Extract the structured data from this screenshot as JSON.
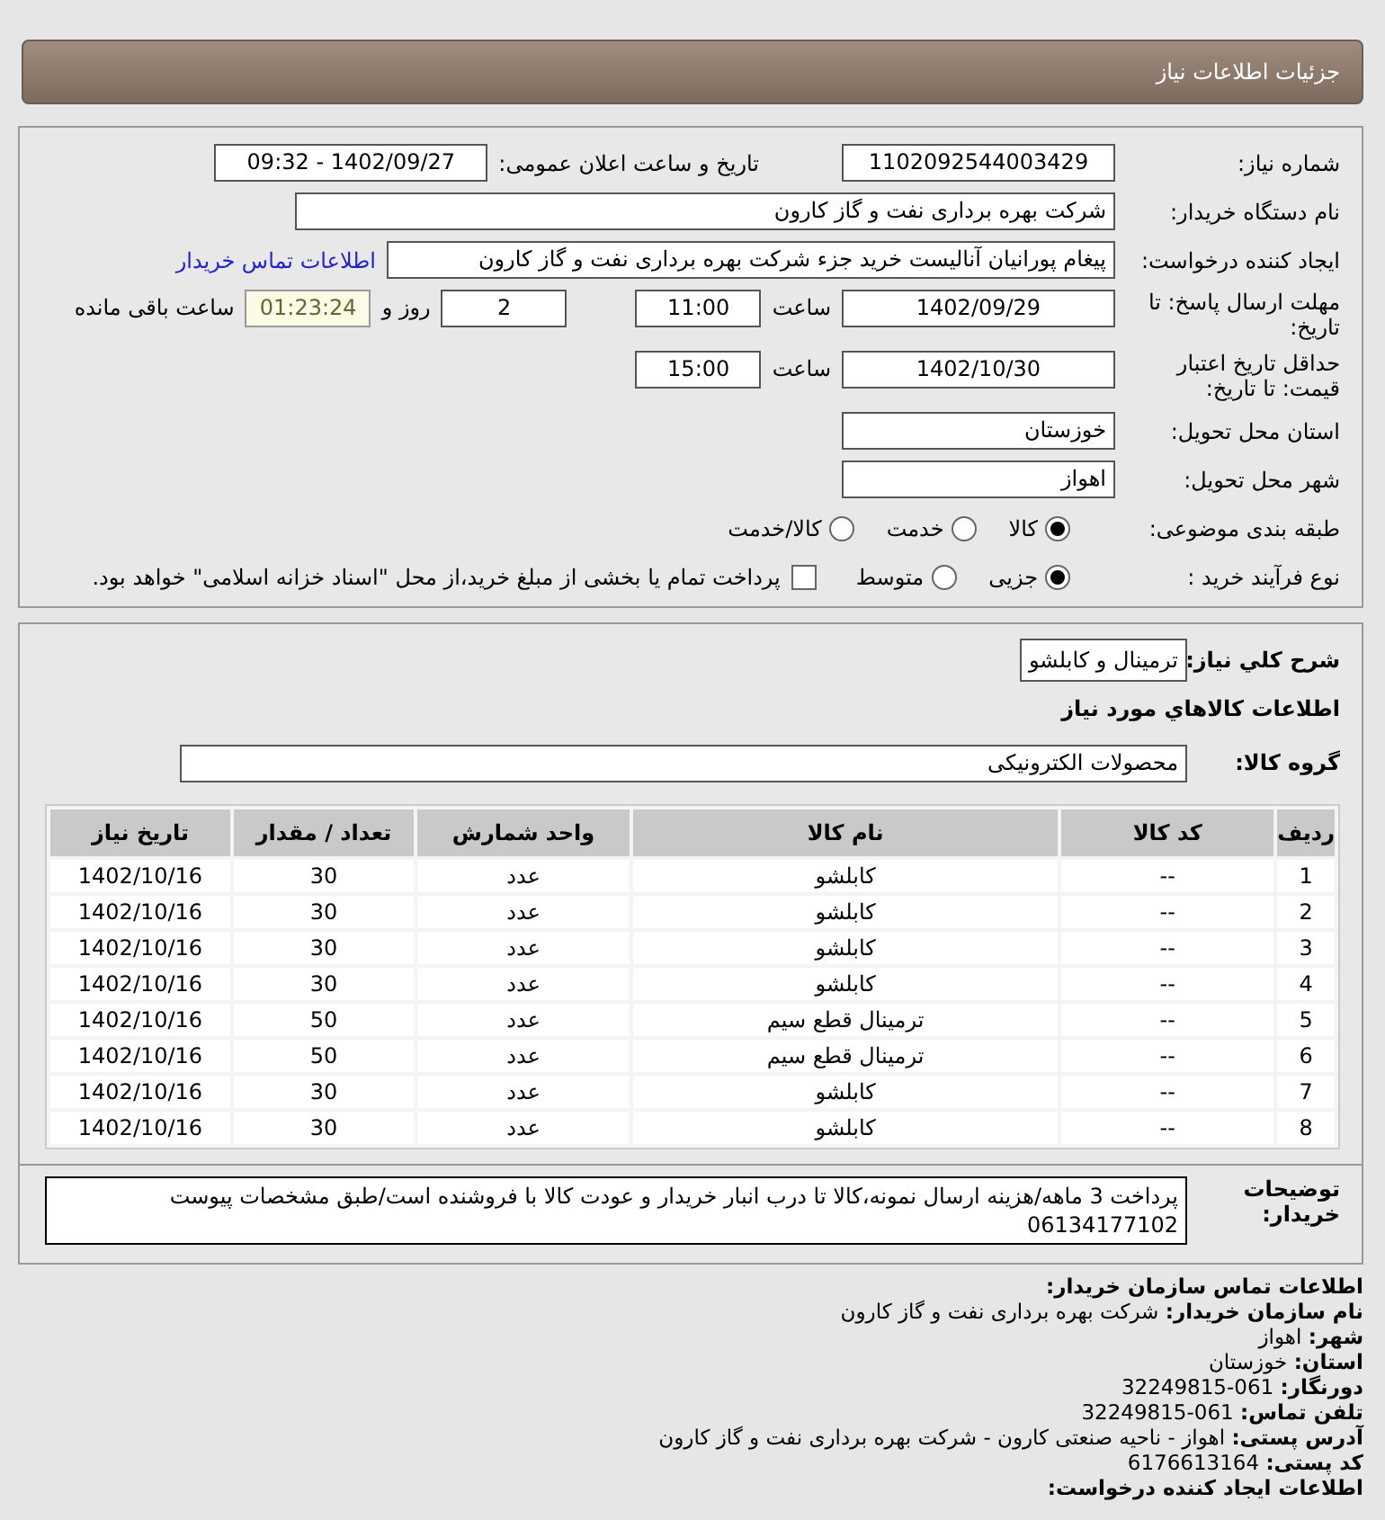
{
  "header": {
    "title": "جزئیات اطلاعات نیاز"
  },
  "form": {
    "need_number": {
      "label": "شماره نیاز:",
      "value": "1102092544003429"
    },
    "announce": {
      "label": "تاریخ و ساعت اعلان عمومی:",
      "value": "1402/09/27 - 09:32"
    },
    "buyer_org": {
      "label": "نام دستگاه خریدار:",
      "value": "شرکت بهره برداری نفت و گاز کارون"
    },
    "creator": {
      "label": "ایجاد کننده درخواست:",
      "value": "پیغام پورانیان آنالیست خرید جزء شرکت بهره برداری نفت و گاز کارون",
      "link": "اطلاعات تماس خریدار"
    },
    "deadline": {
      "label": "مهلت ارسال پاسخ: تا تاریخ:",
      "date": "1402/09/29",
      "time_label": "ساعت",
      "time": "11:00",
      "days": "2",
      "days_label": "روز و",
      "remaining": "01:23:24",
      "remaining_label": "ساعت باقی مانده"
    },
    "validity": {
      "label": "حداقل تاریخ اعتبار قیمت: تا تاریخ:",
      "date": "1402/10/30",
      "time_label": "ساعت",
      "time": "15:00"
    },
    "province": {
      "label": "استان محل تحویل:",
      "value": "خوزستان"
    },
    "city": {
      "label": "شهر محل تحویل:",
      "value": "اهواز"
    },
    "category": {
      "label": "طبقه بندی موضوعی:",
      "options": [
        {
          "label": "کالا",
          "selected": true
        },
        {
          "label": "خدمت",
          "selected": false
        },
        {
          "label": "کالا/خدمت",
          "selected": false
        }
      ]
    },
    "process": {
      "label": "نوع فرآیند خرید :",
      "options": [
        {
          "label": "جزیی",
          "selected": true
        },
        {
          "label": "متوسط",
          "selected": false
        }
      ],
      "payment": {
        "label": "پرداخت تمام یا بخشی از مبلغ خرید،از محل \"اسناد خزانه اسلامی\" خواهد بود.",
        "checked": false
      }
    }
  },
  "summary": {
    "label": "شرح کلي نیاز:",
    "value": "ترمینال و کابلشو",
    "goods_title": "اطلاعات کالاهاي مورد نیاز",
    "group_label": "گروه کالا:",
    "group_value": "محصولات الکترونیکی"
  },
  "table": {
    "columns": [
      "ردیف",
      "کد کالا",
      "نام کالا",
      "واحد شمارش",
      "تعداد / مقدار",
      "تاریخ نیاز"
    ],
    "rows": [
      [
        "1",
        "--",
        "کابلشو",
        "عدد",
        "30",
        "1402/10/16"
      ],
      [
        "2",
        "--",
        "کابلشو",
        "عدد",
        "30",
        "1402/10/16"
      ],
      [
        "3",
        "--",
        "کابلشو",
        "عدد",
        "30",
        "1402/10/16"
      ],
      [
        "4",
        "--",
        "کابلشو",
        "عدد",
        "30",
        "1402/10/16"
      ],
      [
        "5",
        "--",
        "ترمینال قطع سیم",
        "عدد",
        "50",
        "1402/10/16"
      ],
      [
        "6",
        "--",
        "ترمینال قطع سیم",
        "عدد",
        "50",
        "1402/10/16"
      ],
      [
        "7",
        "--",
        "کابلشو",
        "عدد",
        "30",
        "1402/10/16"
      ],
      [
        "8",
        "--",
        "کابلشو",
        "عدد",
        "30",
        "1402/10/16"
      ]
    ]
  },
  "notes": {
    "label": "توضیحات خریدار:",
    "value": "پرداخت 3 ماهه/هزینه ارسال نمونه،کالا تا درب انبار خریدار و عودت کالا با فروشنده است/طبق مشخصات پیوست 06134177102"
  },
  "contact": {
    "title": "اطلاعات تماس سازمان خریدار:",
    "lines": [
      {
        "label": "نام سازمان خریدار:",
        "value": "شرکت بهره برداری نفت و گاز کارون"
      },
      {
        "label": "شهر:",
        "value": "اهواز"
      },
      {
        "label": "استان:",
        "value": "خوزستان"
      },
      {
        "label": "دورنگار:",
        "value": "061-32249815"
      },
      {
        "label": "تلفن تماس:",
        "value": "061-32249815"
      },
      {
        "label": "آدرس پستی:",
        "value": "اهواز - ناحیه صنعتی کارون - شرکت بهره برداری نفت و گاز کارون"
      },
      {
        "label": "کد پستی:",
        "value": "6176613164"
      }
    ],
    "next_title": "اطلاعات ایجاد کننده درخواست:"
  }
}
